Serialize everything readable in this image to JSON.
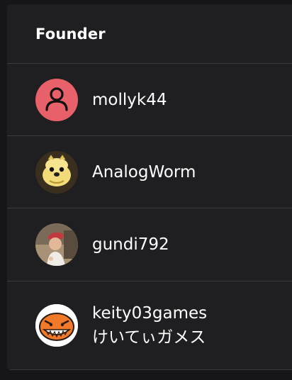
{
  "section": {
    "title": "Founder"
  },
  "members": [
    {
      "username": "mollyk44",
      "avatar_icon": "default-person-avatar-icon",
      "avatar_color": "#e8606a"
    },
    {
      "username": "AnalogWorm",
      "avatar_icon": "yellow-dog-puppet-avatar"
    },
    {
      "username": "gundi792",
      "avatar_icon": "child-photo-avatar"
    },
    {
      "username": "keity03games",
      "display_name": "けいてぃガメス",
      "avatar_icon": "orange-monster-avatar"
    }
  ]
}
